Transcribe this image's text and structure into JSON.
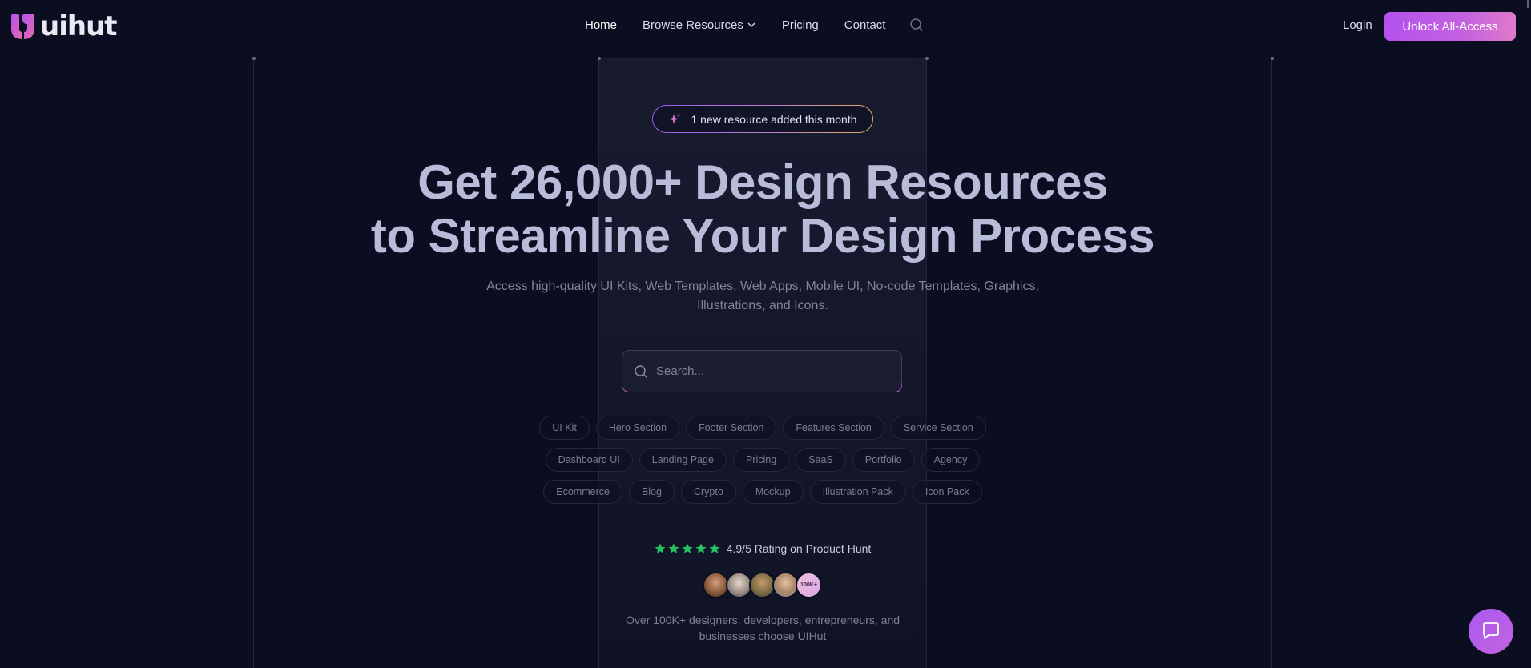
{
  "brand": {
    "name": "uihut",
    "accent": "#c461e0"
  },
  "nav": {
    "items": [
      {
        "label": "Home",
        "active": true
      },
      {
        "label": "Browse Resources",
        "dropdown": true
      },
      {
        "label": "Pricing"
      },
      {
        "label": "Contact"
      }
    ],
    "search_icon": "search-icon"
  },
  "header": {
    "login_label": "Login",
    "cta_label": "Unlock All-Access"
  },
  "badge": {
    "text": "1 new resource added this month",
    "icon": "sparkle-icon"
  },
  "hero": {
    "title_line1": "Get 26,000+ Design Resources",
    "title_line2": "to Streamline Your Design Process",
    "subtitle": "Access high-quality UI Kits, Web Templates, Web Apps, Mobile UI, No-code Templates, Graphics, Illustrations, and Icons."
  },
  "search": {
    "placeholder": "Search...",
    "value": ""
  },
  "tags": {
    "row1": [
      "UI Kit",
      "Hero Section",
      "Footer Section",
      "Features Section",
      "Service Section"
    ],
    "row2": [
      "Dashboard UI",
      "Landing Page",
      "Pricing",
      "SaaS",
      "Portfolio",
      "Agency"
    ],
    "row3": [
      "Ecommerce",
      "Blog",
      "Crypto",
      "Mockup",
      "Illustration Pack",
      "Icon Pack"
    ]
  },
  "rating": {
    "stars": 5,
    "star_color": "#22c55e",
    "text": "4.9/5 Rating on Product Hunt"
  },
  "avatars": {
    "count_label": "100K+"
  },
  "social_proof": {
    "text": "Over 100K+ designers, developers, entrepreneurs, and businesses choose UIHut"
  },
  "chat": {
    "icon": "chat-icon"
  }
}
